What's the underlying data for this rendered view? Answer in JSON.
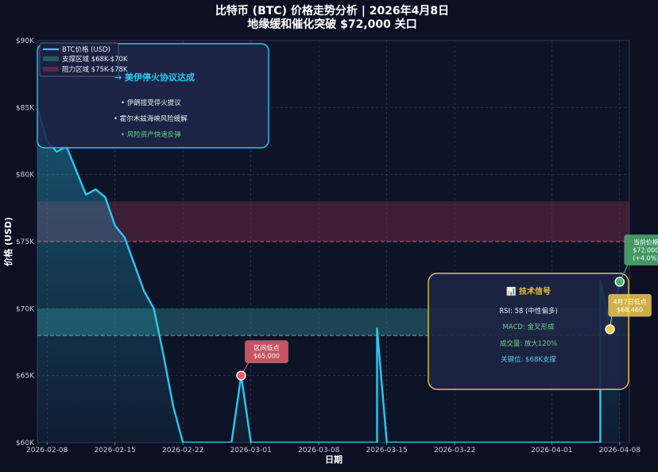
{
  "chart_data": {
    "type": "line",
    "title": "比特币 (BTC) 价格走势分析 | 2026年4月8日",
    "subtitle": "地缘缓和催化突破 $72,000 关口",
    "xlabel": "日期",
    "ylabel": "价格 (USD)",
    "ylim": [
      60000,
      90000
    ],
    "xlim": [
      "2026-02-07",
      "2026-04-09"
    ],
    "x_ticks": [
      "2026-02-08",
      "2026-02-15",
      "2026-02-22",
      "2026-03-01",
      "2026-03-08",
      "2026-03-15",
      "2026-03-22",
      "2026-04-01",
      "2026-04-08"
    ],
    "y_ticks": [
      60000,
      65000,
      70000,
      75000,
      80000,
      85000,
      90000
    ],
    "y_tick_labels": [
      "$60K",
      "$65K",
      "$70K",
      "$75K",
      "$80K",
      "$85K",
      "$90K"
    ],
    "grid": true,
    "legend_position": "top-left",
    "series": [
      {
        "name": "BTC价格 (USD)",
        "color": "#29c8f0",
        "points": [
          [
            "2026-02-07",
            85000
          ],
          [
            "2026-02-08",
            82500
          ],
          [
            "2026-02-09",
            81700
          ],
          [
            "2026-02-10",
            82100
          ],
          [
            "2026-02-11",
            80300
          ],
          [
            "2026-02-12",
            78500
          ],
          [
            "2026-02-13",
            78900
          ],
          [
            "2026-02-14",
            78300
          ],
          [
            "2026-02-15",
            76200
          ],
          [
            "2026-02-16",
            75300
          ],
          [
            "2026-02-17",
            73300
          ],
          [
            "2026-02-18",
            71300
          ],
          [
            "2026-02-19",
            70000
          ],
          [
            "2026-02-20",
            66500
          ],
          [
            "2026-02-21",
            62700
          ],
          [
            "2026-02-22",
            60000
          ],
          [
            "2026-02-27",
            60000
          ],
          [
            "2026-02-28",
            65000
          ],
          [
            "2026-03-01",
            60000
          ],
          [
            "2026-03-14",
            60000
          ],
          [
            "2026-03-14",
            68500
          ],
          [
            "2026-03-15",
            60000
          ],
          [
            "2026-04-06",
            60000
          ],
          [
            "2026-04-06",
            72100
          ],
          [
            "2026-04-07",
            68460
          ],
          [
            "2026-04-08",
            72000
          ]
        ]
      }
    ],
    "bands": [
      {
        "label": "支撑区域 $68K-$70K",
        "y0": 68000,
        "y1": 70000,
        "color": "#2f7f86"
      },
      {
        "label": "阻力区域 $75K-$78K",
        "y0": 75000,
        "y1": 78000,
        "color": "#7a2c4a"
      }
    ],
    "reference_lines": [
      {
        "y": 75000,
        "color": "#e06b7a"
      },
      {
        "y": 68000,
        "color": "#5fd0d0"
      }
    ],
    "annotations": [
      {
        "x": "2026-02-28",
        "y": 65000,
        "label": "区间低点\n$65,000",
        "color": "#e85d6a"
      },
      {
        "x": "2026-04-07",
        "y": 68460,
        "label": "4月7日低点\n$68,460",
        "color": "#f2c94c"
      },
      {
        "x": "2026-04-08",
        "y": 72000,
        "label": "当前价格\n$72,000\n(+4.0%)",
        "color": "#4caf6f"
      }
    ]
  },
  "news_box": {
    "title": "→ 美伊停火协议达成",
    "items": [
      "• 伊朗接受停火提议",
      "• 霍尔木兹海峡风险缓解",
      "• 风险资产快速反弹"
    ]
  },
  "signal_box": {
    "title": "📊 技术信号",
    "items": [
      "RSI: 58 (中性偏多)",
      "MACD: 金叉形成",
      "成交量: 放大120%",
      "关键位: $68K支撑"
    ]
  },
  "colors": {
    "background": "#0c1022",
    "line": "#29c8f0",
    "news_border": "#29c8f0",
    "signal_border": "#e6c13c"
  }
}
